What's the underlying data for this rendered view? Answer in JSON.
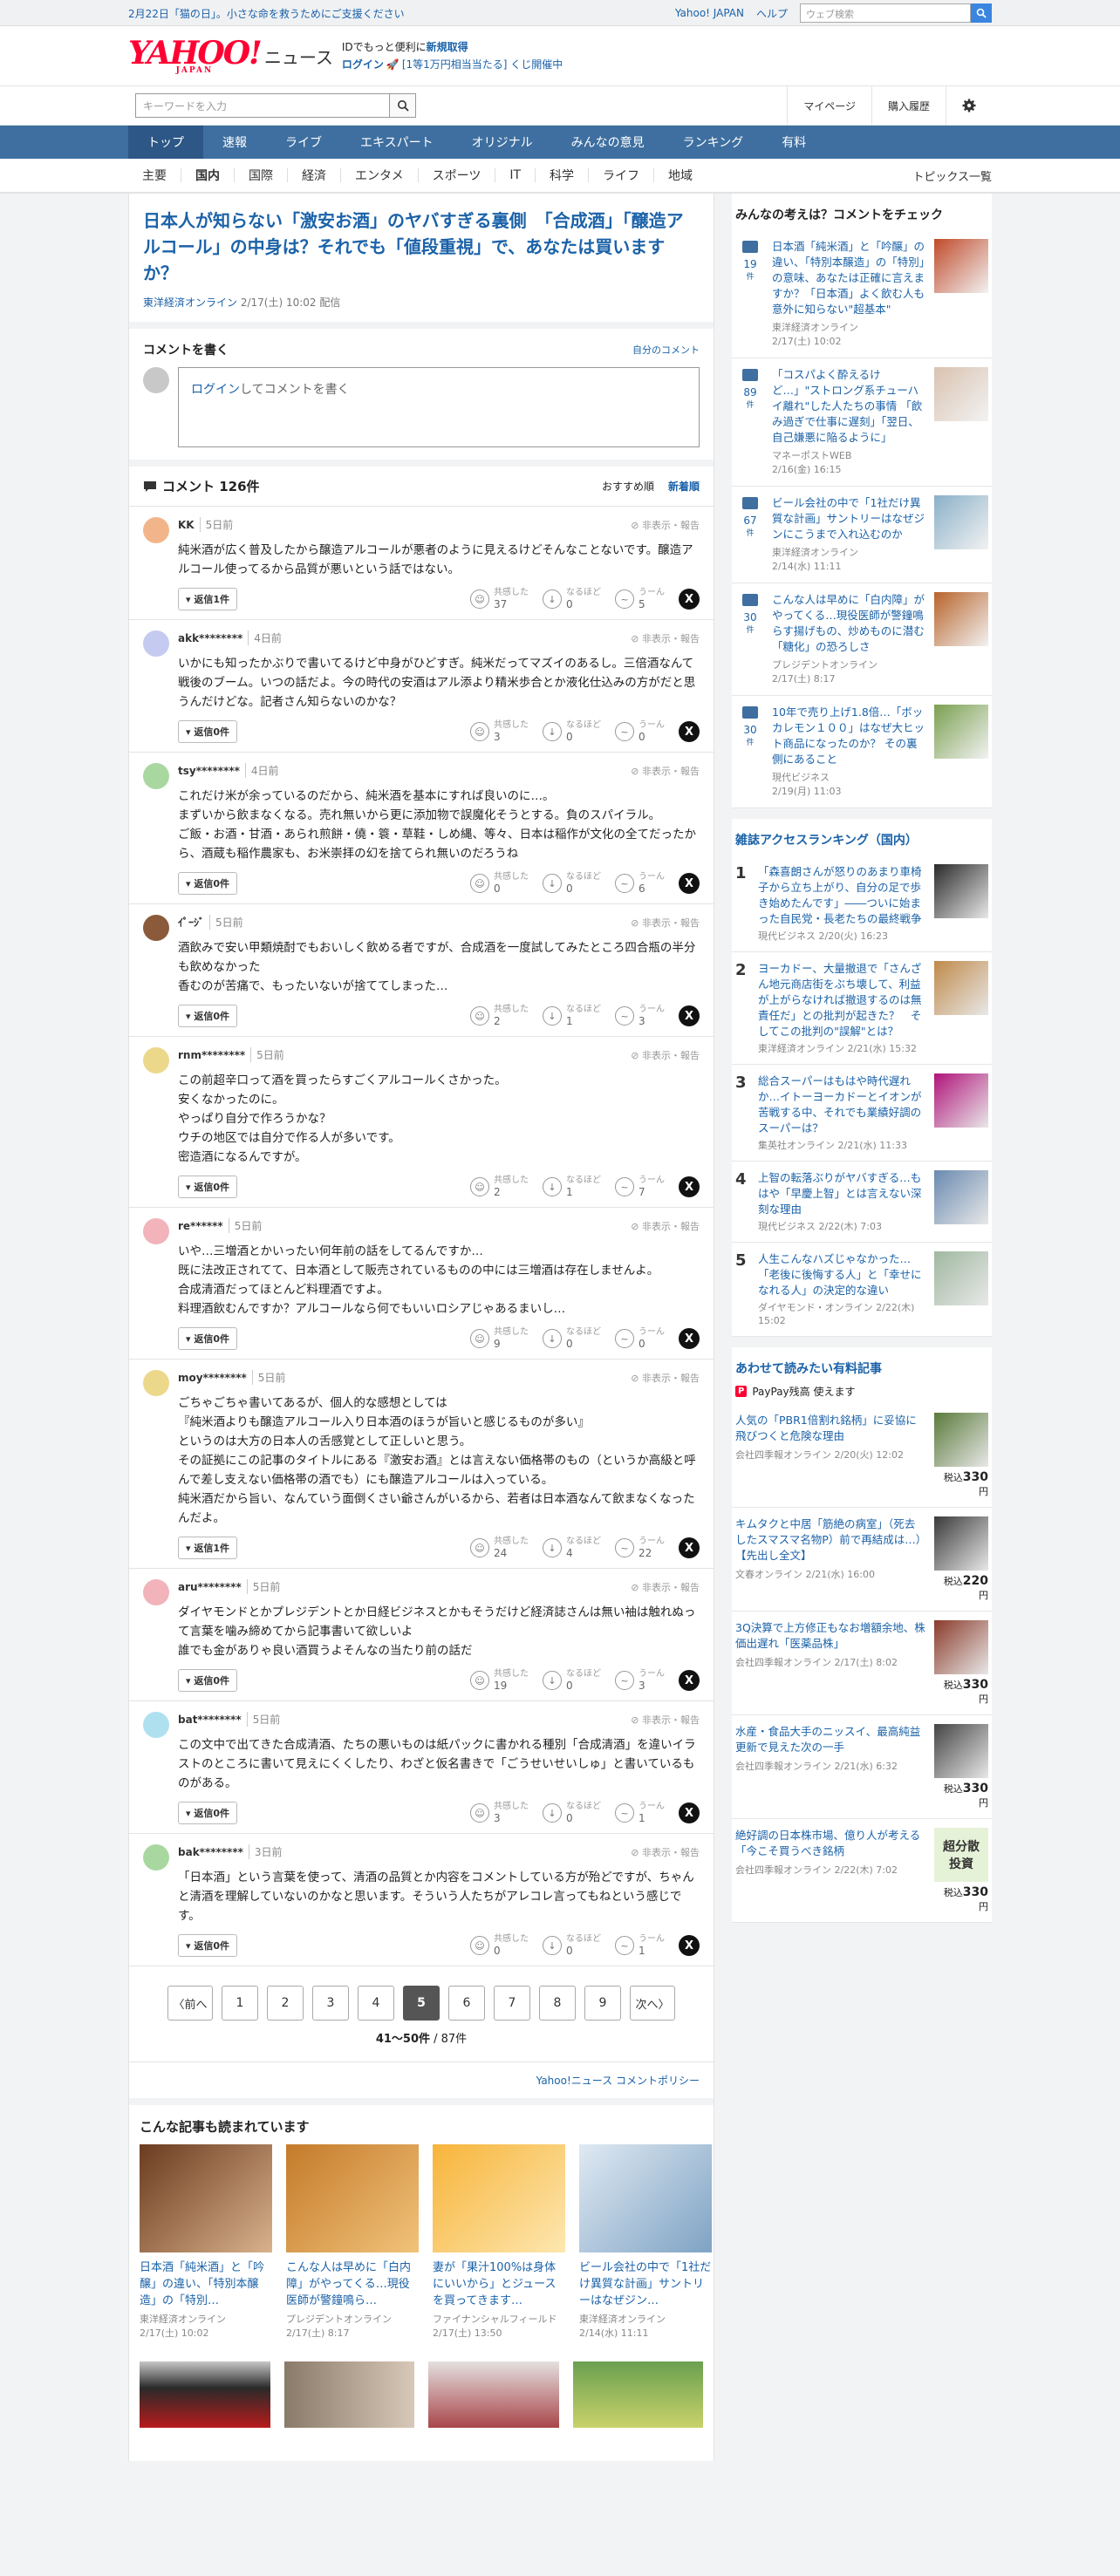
{
  "top": {
    "notice": "2月22日「猫の日」。小さな命を救うためにご支援ください",
    "yj": "Yahoo! JAPAN",
    "help": "ヘルプ",
    "web_placeholder": "ウェブ検索"
  },
  "header": {
    "logo_main": "YAHOO!",
    "logo_sub": "JAPAN",
    "logo_news": "ニュース",
    "line1_pre": "IDでもっと便利に",
    "line1_link": "新規取得",
    "login": "ログイン",
    "lottery": "[1等1万円相当当たる] くじ開催中"
  },
  "search": {
    "placeholder": "キーワードを入力",
    "mypage": "マイページ",
    "history": "購入履歴"
  },
  "nav": [
    "トップ",
    "速報",
    "ライブ",
    "エキスパート",
    "オリジナル",
    "みんなの意見",
    "ランキング",
    "有料"
  ],
  "subnav": [
    "主要",
    "国内",
    "国際",
    "経済",
    "エンタメ",
    "スポーツ",
    "IT",
    "科学",
    "ライフ",
    "地域"
  ],
  "topics": "トピックス一覧",
  "article": {
    "title": "日本人が知らない「激安お酒」のヤバすぎる裏側　「合成酒」「醸造アルコール」の中身は？それでも「値段重視」で、あなたは買いますか？",
    "source": "東洋経済オンライン",
    "date": "2/17(土) 10:02 配信"
  },
  "write": {
    "heading": "コメントを書く",
    "mine": "自分のコメント",
    "login": "ログイン",
    "prompt": "してコメントを書く"
  },
  "comments_head": {
    "title": "コメント 126件",
    "sort1": "おすすめ順",
    "sort2": "新着順"
  },
  "labels": {
    "hide": "非表示・報告",
    "r1": "共感した",
    "r2": "なるほど",
    "r3": "うーん"
  },
  "comments": [
    {
      "user": "KK",
      "time": "5日前",
      "text": "純米酒が広く普及したから醸造アルコールが悪者のように見えるけどそんなことないです。醸造アルコール使ってるから品質が悪いという話ではない。",
      "reply": "返信1件",
      "a": "37",
      "b": "0",
      "c": "5",
      "color": "#f2b58a"
    },
    {
      "user": "akk********",
      "time": "4日前",
      "text": "いかにも知ったかぶりで書いてるけど中身がひどすぎ。純米だってマズイのあるし。三倍酒なんて戦後のブーム。いつの話だよ。今の時代の安酒はアル添より精米歩合とか液化仕込みの方がだと思うんだけどな。記者さん知らないのかな？",
      "reply": "返信0件",
      "a": "3",
      "b": "0",
      "c": "0",
      "color": "#c5caf0"
    },
    {
      "user": "tsy********",
      "time": "4日前",
      "text": "これだけ米が余っているのだから、純米酒を基本にすれば良いのに…。\nまずいから飲まなくなる。売れ無いから更に添加物で誤魔化そうとする。負のスパイラル。\nご飯・お酒・甘酒・あられ煎餅・僥・簑・草鞋・しめ縄、等々、日本は稲作が文化の全てだったから、酒蔵も稲作農家も、お米崇拝の幻を捨てられ無いのだろうね",
      "reply": "返信0件",
      "a": "0",
      "b": "0",
      "c": "6",
      "color": "#a8d8a0"
    },
    {
      "user": "ｲﾟｰｼﾞ",
      "time": "5日前",
      "text": "酒飲みで安い甲類焼酎でもおいしく飲める者ですが、合成酒を一度試してみたところ四合瓶の半分も飲めなかった\n香むのが苦痛で、もったいないが捨ててしまった…",
      "reply": "返信0件",
      "a": "2",
      "b": "1",
      "c": "3",
      "color": "#8a5a3a"
    },
    {
      "user": "rnm********",
      "time": "5日前",
      "text": "この前超辛口って酒を買ったらすごくアルコールくさかった。\n安くなかったのに。\nやっぱり自分で作ろうかな？\nウチの地区では自分で作る人が多いです。\n密造酒になるんですが。",
      "reply": "返信0件",
      "a": "2",
      "b": "1",
      "c": "7",
      "color": "#ecd88a"
    },
    {
      "user": "re******",
      "time": "5日前",
      "text": "いや…三増酒とかいったい何年前の話をしてるんですか…\n既に法改正されてて、日本酒として販売されているものの中には三増酒は存在しませんよ。\n合成清酒だってほとんど料理酒ですよ。\n料理酒飲むんですか？アルコールなら何でもいいロシアじゃあるまいし…",
      "reply": "返信0件",
      "a": "9",
      "b": "0",
      "c": "0",
      "color": "#f2b3bb"
    },
    {
      "user": "moy********",
      "time": "5日前",
      "text": "ごちゃごちゃ書いてあるが、個人的な感想としては\n『純米酒よりも醸造アルコール入り日本酒のほうが旨いと感じるものが多い』\nというのは大方の日本人の舌感覚として正しいと思う。\nその証拠にこの記事のタイトルにある『激安お酒』とは言えない価格帯のもの（というか高級と呼んで差し支えない価格帯の酒でも）にも醸造アルコールは入っている。\n純米酒だから旨い、なんていう面倒くさい爺さんがいるから、若者は日本酒なんて飲まなくなったんだよ。",
      "reply": "返信1件",
      "a": "24",
      "b": "4",
      "c": "22",
      "color": "#ecd88a"
    },
    {
      "user": "aru********",
      "time": "5日前",
      "text": "ダイヤモンドとかプレジデントとか日経ビジネスとかもそうだけど経済誌さんは無い袖は触れぬって言葉を噛み締めてから記事書いて欲しいよ\n誰でも金がありゃ良い酒買うよそんなの当たり前の話だ",
      "reply": "返信0件",
      "a": "19",
      "b": "0",
      "c": "3",
      "color": "#f2b3bb"
    },
    {
      "user": "bat********",
      "time": "5日前",
      "text": "この文中で出てきた合成清酒、たちの悪いものは紙パックに書かれる種別「合成清酒」を違いイラストのところに書いて見えにくくしたり、わざと仮名書きで「ごうせいせいしゅ」と書いているものがある。",
      "reply": "返信0件",
      "a": "3",
      "b": "0",
      "c": "1",
      "color": "#aee0f0"
    },
    {
      "user": "bak********",
      "time": "3日前",
      "text": "「日本酒」という言葉を使って、清酒の品質とか内容をコメントしている方が殆どですが、ちゃんと清酒を理解していないのかなと思います。そういう人たちがアレコレ言ってもねという感じです。",
      "reply": "返信0件",
      "a": "0",
      "b": "0",
      "c": "1",
      "color": "#a8d8a0"
    }
  ],
  "pager": {
    "prev": "〈前へ",
    "next": "次へ〉",
    "pages": [
      "1",
      "2",
      "3",
      "4",
      "5",
      "6",
      "7",
      "8",
      "9"
    ],
    "current": "5",
    "range": "41〜50件",
    "total": " / 87件"
  },
  "policy": "Yahoo!ニュース コメントポリシー",
  "also": {
    "title": "こんな記事も読まれています",
    "items": [
      {
        "t": "日本酒「純米酒」と「吟醸」の違い、「特別本醸造」の「特別…",
        "s": "東洋経済オンライン",
        "d": "2/17(土) 10:02"
      },
      {
        "t": "こんな人は早めに「白内障」がやってくる…現役医師が警鐘鳴ら…",
        "s": "プレジデントオンライン",
        "d": "2/17(土) 8:17"
      },
      {
        "t": "妻が「果汁100%は身体にいいから」とジュースを買ってきます…",
        "s": "ファイナンシャルフィールド",
        "d": "2/17(土) 13:50"
      },
      {
        "t": "ビール会社の中で「1社だけ異質な計画」サントリーはなぜジン…",
        "s": "東洋経済オンライン",
        "d": "2/14(水) 11:11"
      }
    ]
  },
  "side1": {
    "title": "みんなの考えは？コメントをチェック",
    "items": [
      {
        "n": "19",
        "t": "日本酒「純米酒」と「吟醸」の違い、「特別本醸造」の「特別」の意味、あなたは正確に言えますか？「日本酒」よく飲む人も意外に知らない\"超基本\"",
        "s": "東洋経済オンライン",
        "d": "2/17(土) 10:02"
      },
      {
        "n": "89",
        "t": "「コスパよく酔えるけど…」\"ストロング系チューハイ離れ\"した人たちの事情 「飲み過ぎで仕事に遅刻」「翌日、自己嫌悪に陥るように」",
        "s": "マネーポストWEB",
        "d": "2/16(金) 16:15"
      },
      {
        "n": "67",
        "t": "ビール会社の中で「1社だけ異質な計画」サントリーはなぜジンにこうまで入れ込むのか",
        "s": "東洋経済オンライン",
        "d": "2/14(水) 11:11"
      },
      {
        "n": "30",
        "t": "こんな人は早めに「白内障」がやってくる…現役医師が警鐘鳴らす揚げもの、炒めものに潜む「糖化」の恐ろしさ",
        "s": "プレジデントオンライン",
        "d": "2/17(土) 8:17"
      },
      {
        "n": "30",
        "t": "10年で売り上げ1.8倍…「ボッカレモン１００」はなぜ大ヒット商品になったのか？ その裏側にあること",
        "s": "現代ビジネス",
        "d": "2/19(月) 11:03"
      }
    ],
    "unit": "件"
  },
  "side2": {
    "title": "雑誌アクセスランキング（国内）",
    "items": [
      {
        "n": "1",
        "t": "「森喜朗さんが怒りのあまり車椅子から立ち上がり、自分の足で歩き始めたんです」――ついに始まった自民党・長老たちの最終戦争",
        "s": "現代ビジネス 2/20(火) 16:23"
      },
      {
        "n": "2",
        "t": "ヨーカドー、大量撤退で「さんざん地元商店街をぶち壊して、利益が上がらなければ撤退するのは無責任だ」との批判が起きた？　そしてこの批判の\"誤解\"とは？",
        "s": "東洋経済オンライン 2/21(水) 15:32"
      },
      {
        "n": "3",
        "t": "総合スーパーはもはや時代遅れか…イトーヨーカドーとイオンが苦戦する中、それでも業績好調のスーパーは？",
        "s": "集英社オンライン 2/21(水) 11:33"
      },
      {
        "n": "4",
        "t": "上智の転落ぶりがヤバすぎる…もはや「早慶上智」とは言えない深刻な理由",
        "s": "現代ビジネス 2/22(木) 7:03"
      },
      {
        "n": "5",
        "t": "人生こんなハズじゃなかった…「老後に後悔する人」と「幸せになれる人」の決定的な違い",
        "s": "ダイヤモンド・オンライン 2/22(木) 15:02"
      }
    ]
  },
  "side3": {
    "title": "あわせて読みたい有料記事",
    "pp_logo": "P",
    "pp_text": "PayPay残高 使えます",
    "price_pre": "税込",
    "yen": "円",
    "items": [
      {
        "t": "人気の「PBR1倍割れ銘柄」に妥協に飛びつくと危険な理由",
        "s": "会社四季報オンライン 2/20(火) 12:02",
        "p": "330"
      },
      {
        "t": "キムタクと中居「筋絶の病室」（死去したスマスマ名物P）前で再結成は…）【先出し全文】",
        "s": "文春オンライン 2/21(水) 16:00",
        "p": "220"
      },
      {
        "t": "3Q決算で上方修正もなお増額余地、株価出遅れ「医薬品株」",
        "s": "会社四季報オンライン 2/17(土) 8:02",
        "p": "330"
      },
      {
        "t": "水産・食品大手のニッスイ、最高純益更新で見えた次の一手",
        "s": "会社四季報オンライン 2/21(水) 6:32",
        "p": "330"
      },
      {
        "t": "絶好調の日本株市場、億り人が考える「今こそ買うべき銘柄",
        "s": "会社四季報オンライン 2/22(木) 7:02",
        "p": "330"
      }
    ],
    "badge_text": [
      "超分散",
      "投資"
    ]
  }
}
